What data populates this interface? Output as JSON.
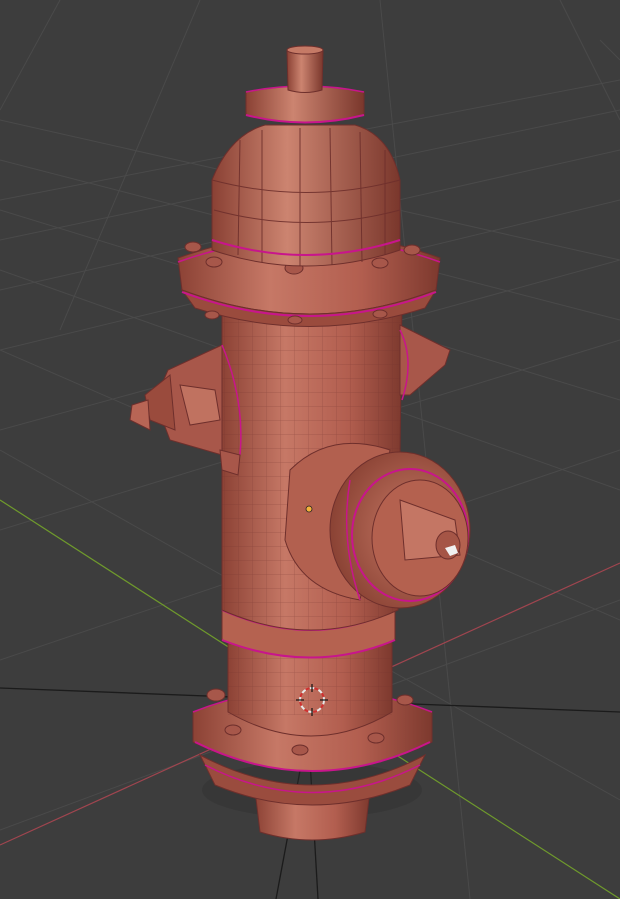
{
  "viewport": {
    "background": "#3d3d3d",
    "grid_color": "#4a4a4a",
    "x_axis_color": "#a0454f",
    "y_axis_color": "#6f9a2c",
    "z_axis_color": "#1b1b1b"
  },
  "model": {
    "body_color": "#b86555",
    "shadow_color": "#8f4638",
    "highlight_color": "#d08a76",
    "wire_color": "#6e2f2c",
    "selected_edge_color": "#c8158c"
  },
  "icons": {
    "cursor": "3d-cursor-icon",
    "origin": "object-origin-icon",
    "light": "light-object-icon"
  }
}
